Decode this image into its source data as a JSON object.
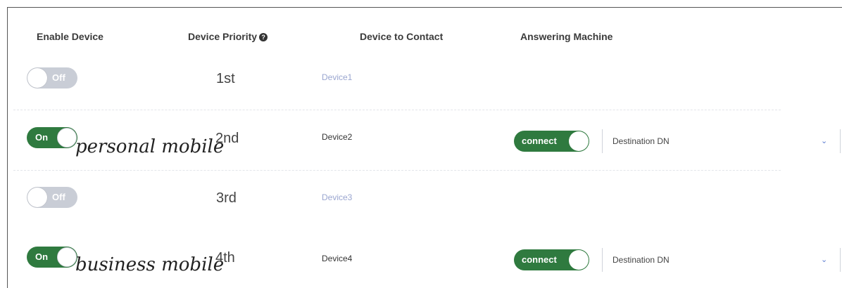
{
  "headers": {
    "enable_device": "Enable Device",
    "device_priority": "Device Priority",
    "device_priority_help": "?",
    "device_to_contact": "Device to Contact",
    "answering_machine": "Answering Machine"
  },
  "rows": [
    {
      "toggle_label": "Off",
      "enabled": false,
      "annotation": "",
      "priority": "1st",
      "device": "Device1"
    },
    {
      "toggle_label": "On",
      "enabled": true,
      "annotation": "personal mobile",
      "priority": "2nd",
      "device": "Device2",
      "answering_machine": {
        "label": "connect",
        "destination": "Destination DN",
        "dropdown_icon": "chevron-down-icon"
      }
    },
    {
      "toggle_label": "Off",
      "enabled": false,
      "annotation": "",
      "priority": "3rd",
      "device": "Device3"
    },
    {
      "toggle_label": "On",
      "enabled": true,
      "annotation": "business mobile",
      "priority": "4th",
      "device": "Device4",
      "answering_machine": {
        "label": "connect",
        "destination": "Destination DN",
        "dropdown_icon": "chevron-down-icon"
      }
    }
  ],
  "colors": {
    "toggle_on": "#2f7a3f",
    "toggle_off": "#c9cdd6",
    "device_disabled_text": "#9aa6d0",
    "chevron": "#5b7bd0"
  }
}
